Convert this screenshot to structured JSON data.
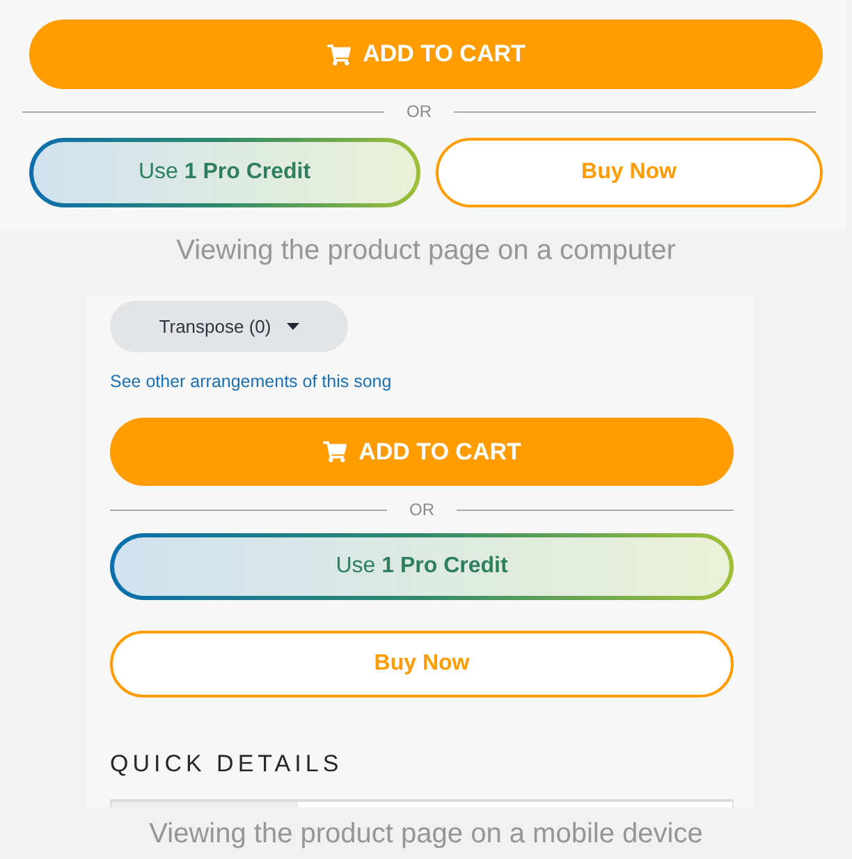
{
  "desktop_view": {
    "add_to_cart_button": "ADD TO CART",
    "divider_label": "OR",
    "pro_credit_button": "Use **1 Pro Credit**",
    "buy_now_button": "Buy Now"
  },
  "desktop_caption": "Viewing the product page on a computer",
  "mobile_view": {
    "transpose_dropdown": "Transpose (0)",
    "arrangements_link": "See other arrangements of this song",
    "add_to_cart_button": "ADD TO CART",
    "divider_label": "OR",
    "pro_credit_button": "Use **1 Pro Credit**",
    "buy_now_button": "Buy Now",
    "section_title": "QUICK DETAILS"
  },
  "mobile_caption": "Viewing the product page on a mobile device"
}
